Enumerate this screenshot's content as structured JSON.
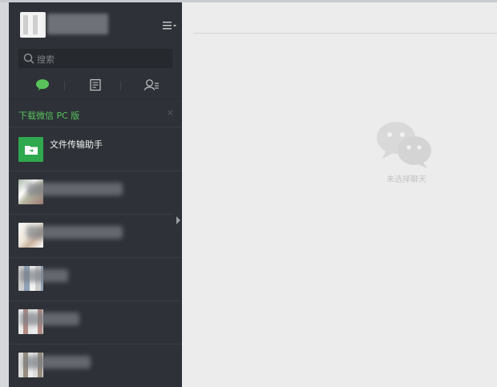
{
  "sidebar": {
    "search": {
      "placeholder": "搜索"
    },
    "tabs": [
      {
        "icon": "chat-bubble-icon",
        "active": true
      },
      {
        "icon": "article-icon",
        "active": false
      },
      {
        "icon": "contacts-icon",
        "active": false
      }
    ],
    "download_banner": {
      "label": "下载微信 PC 版",
      "close": "×"
    },
    "conversations": [
      {
        "title": "文件传输助手"
      }
    ]
  },
  "main": {
    "empty_state_text": "未选择聊天"
  },
  "colors": {
    "sidebar_bg": "#2e3238",
    "accent_green": "#58c35b",
    "main_bg": "#ececec"
  }
}
